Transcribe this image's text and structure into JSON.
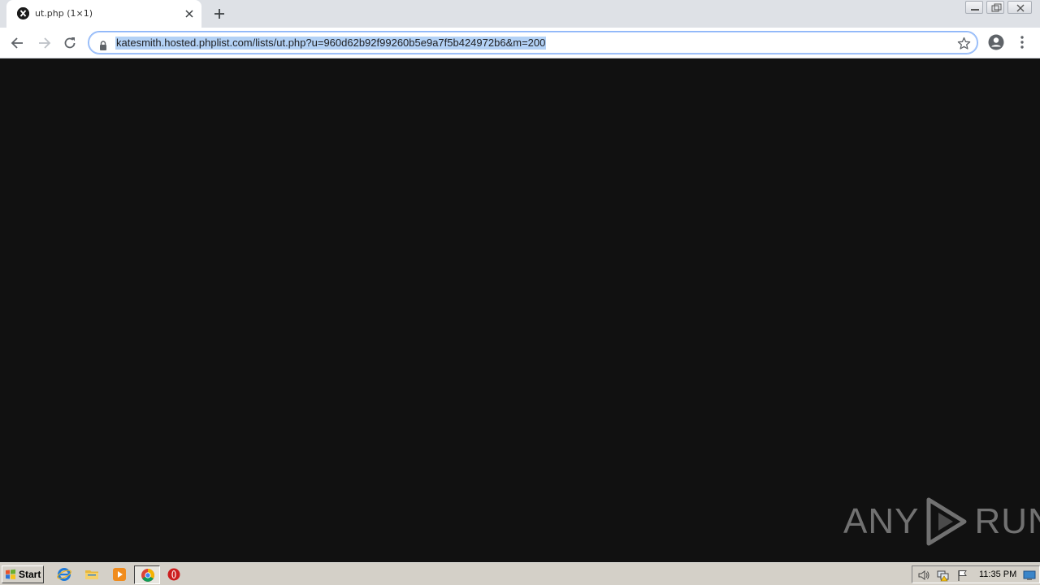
{
  "browser": {
    "tab": {
      "title": "ut.php (1×1)",
      "favicon": "phplist-icon"
    },
    "omnibox": {
      "url": "katesmith.hosted.phplist.com/lists/ut.php?u=960d62b92f99260b5e9a7f5b424972b6&m=200",
      "secure": true
    },
    "toolbar_icons": [
      "back-arrow-icon",
      "forward-arrow-icon",
      "reload-icon",
      "lock-icon",
      "bookmark-star-icon",
      "profile-icon",
      "menu-icon"
    ]
  },
  "content": {
    "background": "#111111",
    "watermark": {
      "left_text": "ANY",
      "right_text": "RUN"
    }
  },
  "taskbar": {
    "start_label": "Start",
    "apps": [
      "internet-explorer-icon",
      "file-explorer-icon",
      "media-player-icon",
      "chrome-icon",
      "opera-icon"
    ],
    "tray": [
      "volume-icon",
      "network-icon",
      "flag-icon",
      "desktop-icon"
    ],
    "clock": "11:35 PM"
  },
  "colors": {
    "tabstrip": "#dee1e6",
    "selection": "#b3d1f5",
    "taskbar": "#d4d0c8",
    "omnibox_border": "#8ab4f8"
  }
}
